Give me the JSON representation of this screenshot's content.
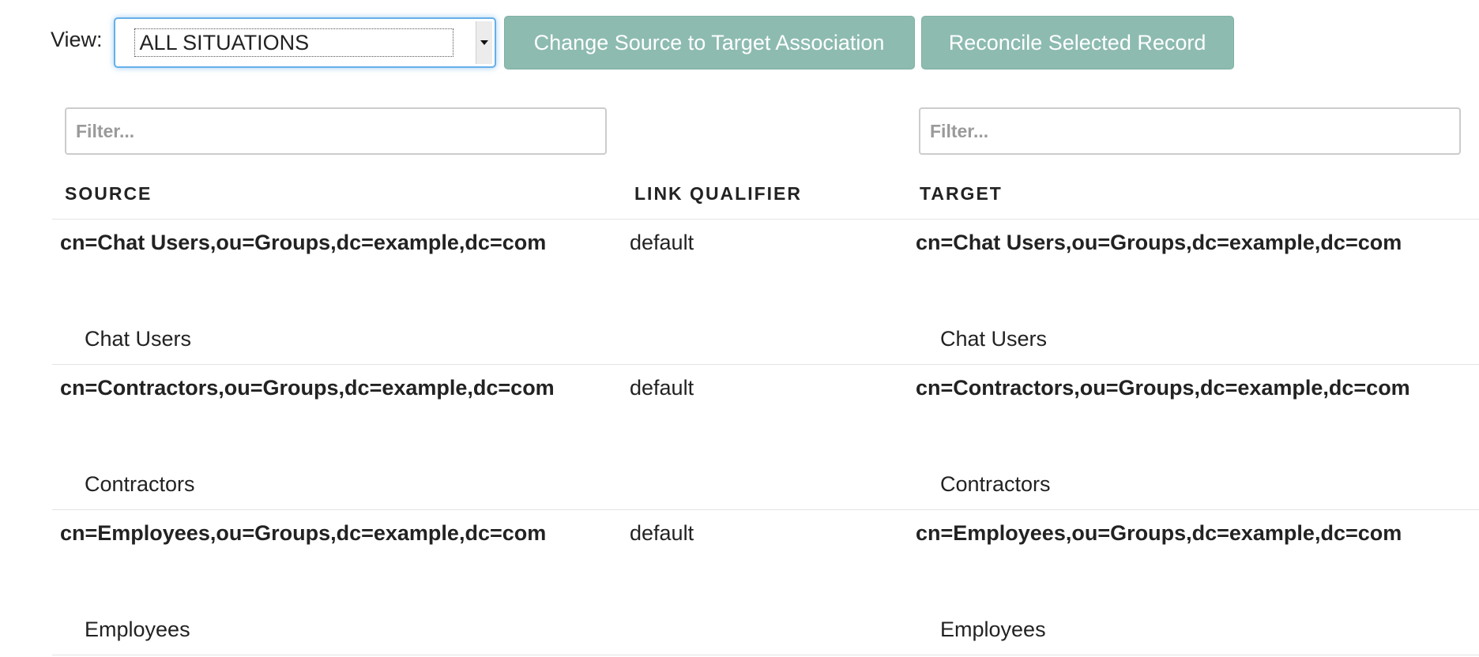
{
  "toolbar": {
    "view_label": "View:",
    "view_selected": "ALL SITUATIONS",
    "change_button_label": "Change Source to Target Association",
    "reconcile_button_label": "Reconcile Selected Record"
  },
  "filters": {
    "source_placeholder": "Filter...",
    "target_placeholder": "Filter..."
  },
  "table": {
    "headers": {
      "source": "SOURCE",
      "link_qualifier": "LINK QUALIFIER",
      "target": "TARGET"
    },
    "rows": [
      {
        "source_dn": "cn=Chat Users,ou=Groups,dc=example,dc=com",
        "source_cn": "Chat Users",
        "link_qualifier": "default",
        "target_dn": "cn=Chat Users,ou=Groups,dc=example,dc=com",
        "target_cn": "Chat Users"
      },
      {
        "source_dn": "cn=Contractors,ou=Groups,dc=example,dc=com",
        "source_cn": "Contractors",
        "link_qualifier": "default",
        "target_dn": "cn=Contractors,ou=Groups,dc=example,dc=com",
        "target_cn": "Contractors"
      },
      {
        "source_dn": "cn=Employees,ou=Groups,dc=example,dc=com",
        "source_cn": "Employees",
        "link_qualifier": "default",
        "target_dn": "cn=Employees,ou=Groups,dc=example,dc=com",
        "target_cn": "Employees"
      }
    ]
  },
  "colors": {
    "button_bg": "#8dbbb0",
    "focus_border": "#66afe9"
  },
  "icons": {
    "select_arrow": "caret-down-icon"
  }
}
